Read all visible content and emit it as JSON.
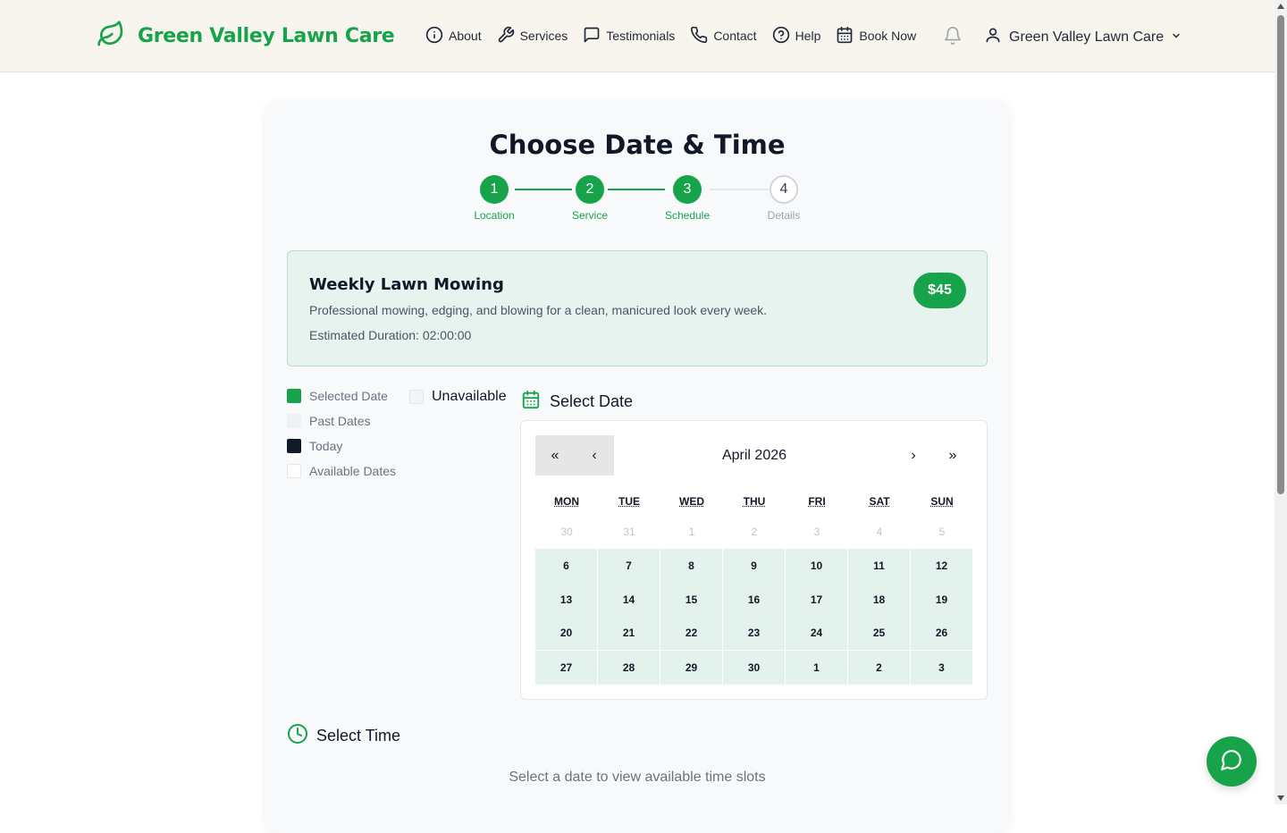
{
  "brand": {
    "name": "Green Valley Lawn Care",
    "icon": "leaf-icon",
    "color": "#16a34a"
  },
  "nav": {
    "items": [
      {
        "label": "About",
        "icon": "info-icon"
      },
      {
        "label": "Services",
        "icon": "wrench-icon"
      },
      {
        "label": "Testimonials",
        "icon": "message-square-icon"
      },
      {
        "label": "Contact",
        "icon": "phone-icon"
      },
      {
        "label": "Help",
        "icon": "help-circle-icon"
      },
      {
        "label": "Book Now",
        "icon": "calendar-icon"
      }
    ],
    "notifications_icon": "bell-icon",
    "user_label": "Green Valley Lawn Care"
  },
  "page": {
    "title": "Choose Date & Time"
  },
  "steps": [
    {
      "number": "1",
      "label": "Location",
      "status": "complete"
    },
    {
      "number": "2",
      "label": "Service",
      "status": "complete"
    },
    {
      "number": "3",
      "label": "Schedule",
      "status": "current"
    },
    {
      "number": "4",
      "label": "Details",
      "status": "upcoming"
    }
  ],
  "service": {
    "name": "Weekly Lawn Mowing",
    "description": "Professional mowing, edging, and blowing for a clean, manicured look every week.",
    "duration": "Estimated Duration: 02:00:00",
    "price": "$45"
  },
  "legend": {
    "selected": "Selected Date",
    "unavailable": "Unavailable",
    "past": "Past Dates",
    "today": "Today",
    "available": "Available Dates"
  },
  "calendar": {
    "heading": "Select Date",
    "month_label": "April 2026",
    "prev_year": "«",
    "prev_month": "‹",
    "next_month": "›",
    "next_year": "»",
    "weekdays": [
      "MON",
      "TUE",
      "WED",
      "THU",
      "FRI",
      "SAT",
      "SUN"
    ],
    "weeks": [
      [
        "30",
        "31",
        "1",
        "2",
        "3",
        "4",
        "5"
      ],
      [
        "6",
        "7",
        "8",
        "9",
        "10",
        "11",
        "12"
      ],
      [
        "13",
        "14",
        "15",
        "16",
        "17",
        "18",
        "19"
      ],
      [
        "20",
        "21",
        "22",
        "23",
        "24",
        "25",
        "26"
      ],
      [
        "27",
        "28",
        "29",
        "30",
        "1",
        "2",
        "3"
      ]
    ],
    "past_weeks": 1
  },
  "time": {
    "heading": "Select Time",
    "hint": "Select a date to view available time slots"
  },
  "colors": {
    "accent": "#16a34a",
    "available_day": "#e3f2ec",
    "today": "#111827",
    "past": "#eef1f6"
  },
  "chat": {
    "icon": "chat-bubble-icon"
  }
}
